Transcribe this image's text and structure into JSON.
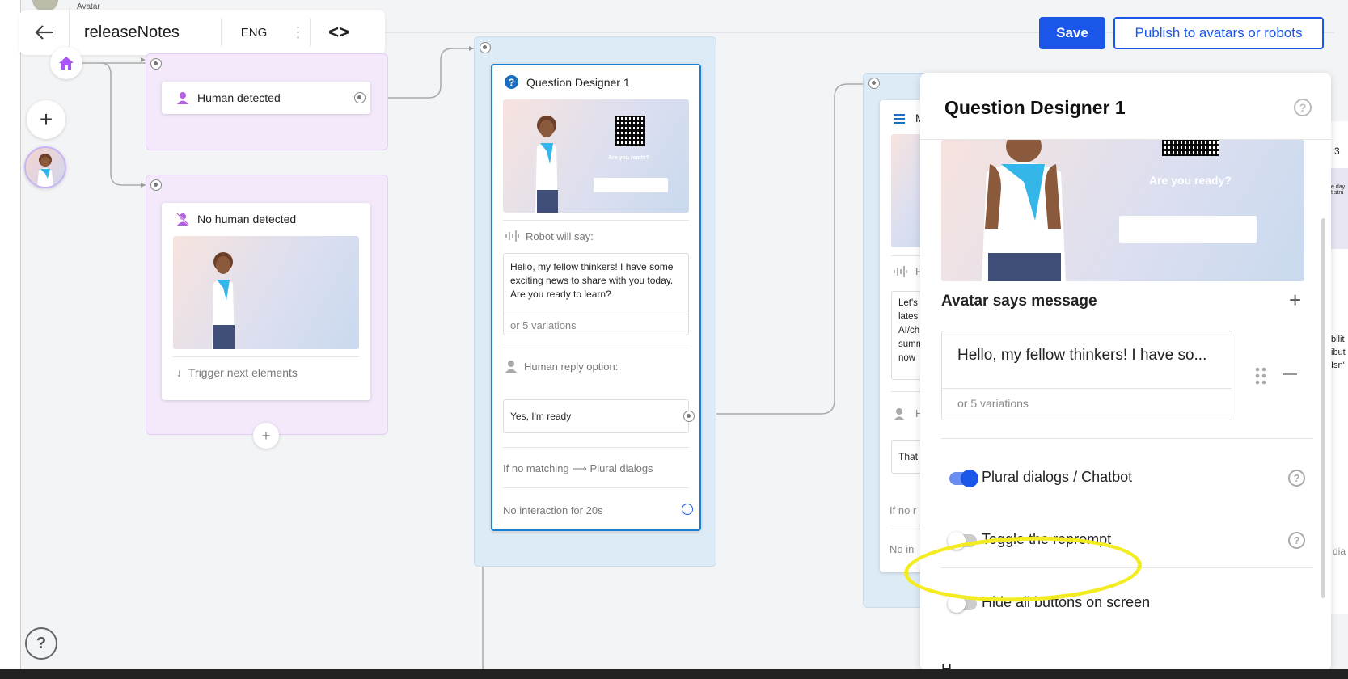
{
  "topbar": {
    "avatar_tab_label": "Avatar",
    "title": "releaseNotes",
    "language": "ENG",
    "more_icon": "⋮",
    "code_icon": "<>"
  },
  "actions": {
    "save_label": "Save",
    "publish_label": "Publish to avatars or robots"
  },
  "nodes": {
    "human_detected": {
      "label": "Human detected"
    },
    "no_human_detected": {
      "label": "No human detected",
      "trigger": "Trigger next elements"
    },
    "question_designer": {
      "title": "Question Designer 1",
      "ready_text": "Are you ready?",
      "robot_label": "Robot will say:",
      "message": "Hello, my fellow thinkers! I have some exciting news to share with you today. Are you ready to learn?",
      "variations": "or 5 variations",
      "reply_label": "Human reply option:",
      "reply_option": "Yes, I'm ready",
      "no_match": "If no matching ⟶ Plural dialogs",
      "no_interaction": "No interaction for 20s"
    },
    "message_node": {
      "title_partial": "M",
      "label_partial": "F",
      "text_partial": [
        "Let's",
        "lates",
        "AI/ch",
        "summ",
        "now"
      ],
      "reply_partial": "H",
      "option_partial": "That",
      "no_match_partial": "If no r",
      "no_interaction_partial": "No in"
    }
  },
  "panel": {
    "title": "Question Designer 1",
    "ready_text": "Are you ready?",
    "section_title": "Avatar says message",
    "message_preview": "Hello, my fellow thinkers! I have so...",
    "variations": "or 5 variations",
    "toggles": [
      {
        "label": "Plural dialogs / Chatbot",
        "on": true
      },
      {
        "label": "Toggle the reprompt",
        "on": false
      },
      {
        "label": "Hide all buttons on screen",
        "on": false
      }
    ],
    "cut_off_label": "H"
  },
  "edge_partial": {
    "num": "3",
    "lines": [
      "e day",
      "t stru"
    ],
    "lines2": [
      "bilit",
      "ibut",
      "Isn'"
    ],
    "dia": "dia"
  },
  "colors": {
    "accent": "#1a56e8",
    "purple_group": "#f3e9fb",
    "blue_group": "#ddebf6",
    "highlight": "#f4ec22"
  }
}
